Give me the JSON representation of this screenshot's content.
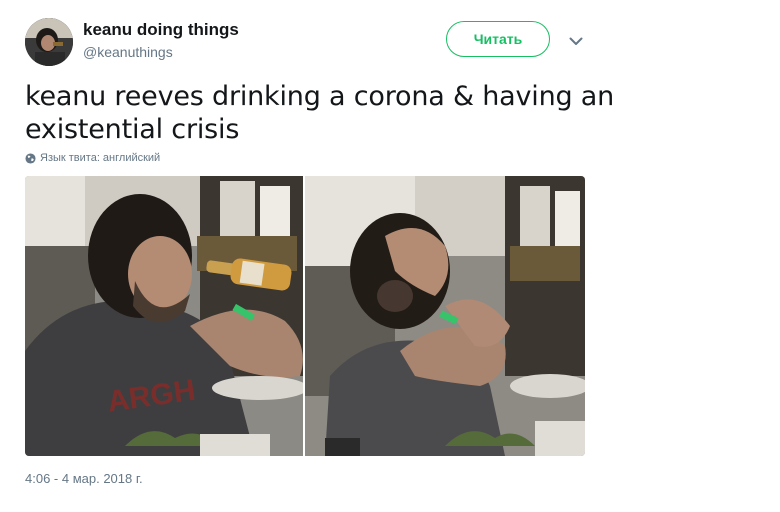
{
  "author": {
    "display_name": "keanu doing things",
    "handle": "@keanuthings"
  },
  "follow_button": {
    "label": "Читать"
  },
  "tweet": {
    "text": "keanu reeves drinking a corona & having an existential crisis",
    "language_note": "Язык твита: английский",
    "timestamp": "4:06 - 4 мар. 2018 г."
  },
  "media": {
    "count": 2,
    "photos": [
      "keanu drinking beer",
      "keanu holding head"
    ]
  },
  "colors": {
    "accent_green": "#17bf63",
    "secondary_text": "#657786",
    "primary_text": "#14171a"
  },
  "icons": {
    "menu": "chevron-down-icon",
    "language": "globe-icon"
  }
}
